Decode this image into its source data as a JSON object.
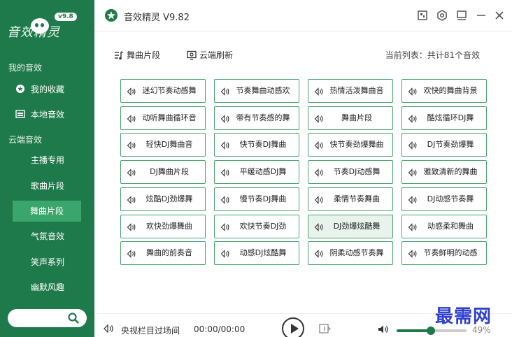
{
  "logo": {
    "text": "音效精灵",
    "version": "v9.8"
  },
  "sidebar": {
    "my_section": "我的音效",
    "my_items": [
      {
        "label": "我的收藏",
        "icon": "favorite-icon"
      },
      {
        "label": "本地音效",
        "icon": "local-folder-icon"
      }
    ],
    "cloud_section": "云端音效",
    "cloud_items": [
      {
        "label": "主播专用"
      },
      {
        "label": "歌曲片段"
      },
      {
        "label": "舞曲片段",
        "active": true
      },
      {
        "label": "气氛音效"
      },
      {
        "label": "笑声系列"
      },
      {
        "label": "幽默风趣"
      }
    ]
  },
  "header": {
    "title": "音效精灵 V9.82"
  },
  "toolbar": {
    "dance_label": "舞曲片段",
    "cloud_refresh": "云端刷新",
    "list_count": "当前列表：共计81个音效"
  },
  "grid": {
    "items": [
      "迷幻节奏动感舞",
      "节奏舞曲动感欢",
      "热情活泼舞曲音",
      "欢快的舞曲背景",
      "动听舞曲循环音",
      "带有节奏感的舞",
      "舞曲片段",
      "酷炫循环DJ舞",
      "轻快DJ舞曲音",
      "快节奏DJ舞曲",
      "快节奏劲爆舞曲",
      "DJ节奏劲爆舞",
      "DJ舞曲片段",
      "平缓动感DJ舞",
      "节奏DJ动感舞",
      "雅致清新的舞曲",
      "炫酷DJ劲爆舞",
      "慢节奏DJ舞曲",
      "柔情节奏舞曲",
      "DJ动感节奏舞",
      "欢快劲爆舞曲",
      "欢快节奏DJ劲",
      "DJ劲爆炫酷舞",
      "动感柔和舞曲",
      "舞曲的前奏音",
      "动感DJ炫酷舞",
      "阴柔动感节奏舞",
      "节奏鲜明的动感"
    ],
    "selected_index": 22
  },
  "player": {
    "now_playing": "央视栏目过场间",
    "time": "00:00/00:00",
    "volume": 49,
    "volume_label": "49%"
  },
  "watermark": "最需网",
  "colors": {
    "sidebar": "#1f7a4b",
    "active": "#3aa66b",
    "button_border": "#4aa36d"
  }
}
